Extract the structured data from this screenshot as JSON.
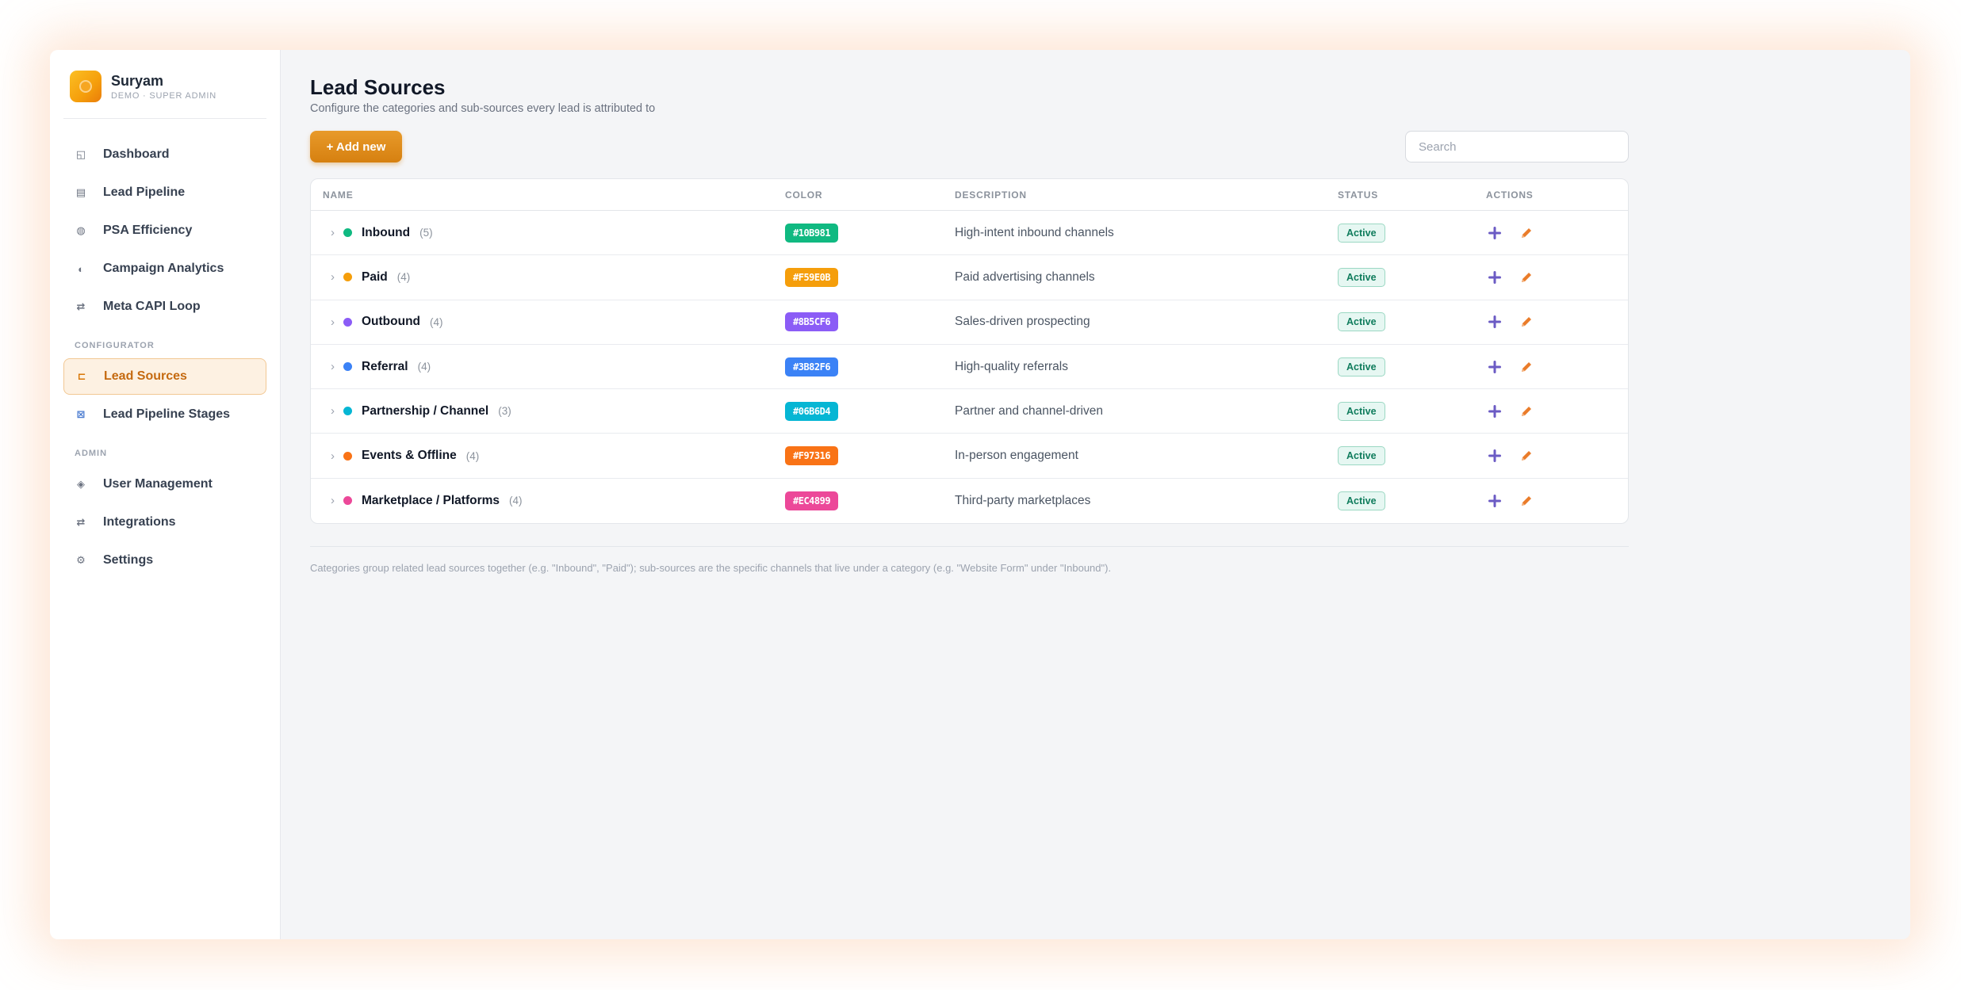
{
  "brand": {
    "name": "Suryam",
    "subtitle": "DEMO · SUPER ADMIN"
  },
  "sidebar": {
    "main_items": [
      {
        "label": "Dashboard",
        "icon": "dashboard-icon"
      },
      {
        "label": "Lead Pipeline",
        "icon": "pipeline-icon"
      },
      {
        "label": "PSA Efficiency",
        "icon": "efficiency-icon"
      },
      {
        "label": "Campaign Analytics",
        "icon": "analytics-icon"
      },
      {
        "label": "Meta CAPI Loop",
        "icon": "loop-arrows-icon"
      }
    ],
    "configurator_label": "CONFIGURATOR",
    "configurator_items": [
      {
        "label": "Lead Sources",
        "icon": "tag-icon",
        "active": true
      },
      {
        "label": "Lead Pipeline Stages",
        "icon": "stages-icon",
        "active": false
      }
    ],
    "admin_label": "ADMIN",
    "admin_items": [
      {
        "label": "User Management",
        "icon": "users-icon"
      },
      {
        "label": "Integrations",
        "icon": "integrations-icon"
      },
      {
        "label": "Settings",
        "icon": "gear-icon"
      }
    ]
  },
  "page": {
    "title": "Lead Sources",
    "subtitle": "Configure the categories and sub-sources every lead is attributed to",
    "add_button": "+ Add new",
    "search_placeholder": "Search"
  },
  "table": {
    "headers": {
      "name": "NAME",
      "color": "COLOR",
      "description": "DESCRIPTION",
      "status": "STATUS",
      "actions": "ACTIONS"
    },
    "rows": [
      {
        "name": "Inbound",
        "count": "(5)",
        "color": "#10B981",
        "description": "High-intent inbound channels",
        "status": "Active"
      },
      {
        "name": "Paid",
        "count": "(4)",
        "color": "#F59E0B",
        "description": "Paid advertising channels",
        "status": "Active"
      },
      {
        "name": "Outbound",
        "count": "(4)",
        "color": "#8B5CF6",
        "description": "Sales-driven prospecting",
        "status": "Active"
      },
      {
        "name": "Referral",
        "count": "(4)",
        "color": "#3B82F6",
        "description": "High-quality referrals",
        "status": "Active"
      },
      {
        "name": "Partnership / Channel",
        "count": "(3)",
        "color": "#06B6D4",
        "description": "Partner and channel-driven",
        "status": "Active"
      },
      {
        "name": "Events & Offline",
        "count": "(4)",
        "color": "#F97316",
        "description": "In-person engagement",
        "status": "Active"
      },
      {
        "name": "Marketplace / Platforms",
        "count": "(4)",
        "color": "#EC4899",
        "description": "Third-party marketplaces",
        "status": "Active"
      }
    ]
  },
  "footer_note": "Categories group related lead sources together (e.g. \"Inbound\", \"Paid\"); sub-sources are the specific channels that live under a category (e.g. \"Website Form\" under \"Inbound\").",
  "colors": {
    "accent": "#D97706",
    "active_bg": "#FDF1E2",
    "status_green": "#0F7C5C",
    "add_icon": "#6B5BC4",
    "edit_icon": "#EA7C2A"
  }
}
